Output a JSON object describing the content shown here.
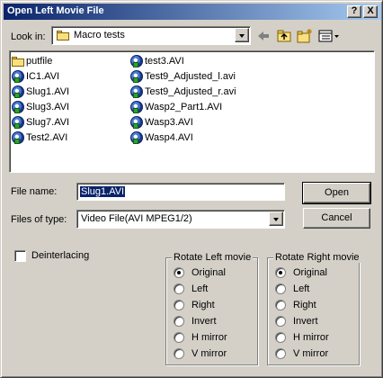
{
  "window": {
    "title": "Open Left Movie File"
  },
  "titlebar": {
    "help": "?",
    "close": "X"
  },
  "lookin": {
    "label": "Look in:",
    "value": "Macro tests"
  },
  "files": [
    {
      "name": "putfile",
      "type": "folder"
    },
    {
      "name": "IC1.AVI",
      "type": "avi"
    },
    {
      "name": "Slug1.AVI",
      "type": "avi"
    },
    {
      "name": "Slug3.AVI",
      "type": "avi"
    },
    {
      "name": "Slug7.AVI",
      "type": "avi"
    },
    {
      "name": "Test2.AVI",
      "type": "avi"
    },
    {
      "name": "test3.AVI",
      "type": "avi"
    },
    {
      "name": "Test9_Adjusted_l.avi",
      "type": "avi"
    },
    {
      "name": "Test9_Adjusted_r.avi",
      "type": "avi"
    },
    {
      "name": "Wasp2_Part1.AVI",
      "type": "avi"
    },
    {
      "name": "Wasp3.AVI",
      "type": "avi"
    },
    {
      "name": "Wasp4.AVI",
      "type": "avi"
    }
  ],
  "filename": {
    "label": "File name:",
    "value": "Slug1.AVI"
  },
  "filetype": {
    "label": "Files of type:",
    "value": "Video File(AVI MPEG1/2)"
  },
  "buttons": {
    "open": "Open",
    "cancel": "Cancel"
  },
  "deinterlacing": {
    "label": "Deinterlacing",
    "checked": false
  },
  "rotate_left": {
    "title": "Rotate Left movie",
    "options": [
      "Original",
      "Left",
      "Right",
      "Invert",
      "H mirror",
      "V mirror"
    ],
    "selected": "Original"
  },
  "rotate_right": {
    "title": "Rotate Right movie",
    "options": [
      "Original",
      "Left",
      "Right",
      "Invert",
      "H mirror",
      "V mirror"
    ],
    "selected": "Original"
  },
  "colors": {
    "title_start": "#0a246a",
    "title_end": "#a6caf0",
    "face": "#d4d0c8",
    "selection": "#0a246a"
  }
}
